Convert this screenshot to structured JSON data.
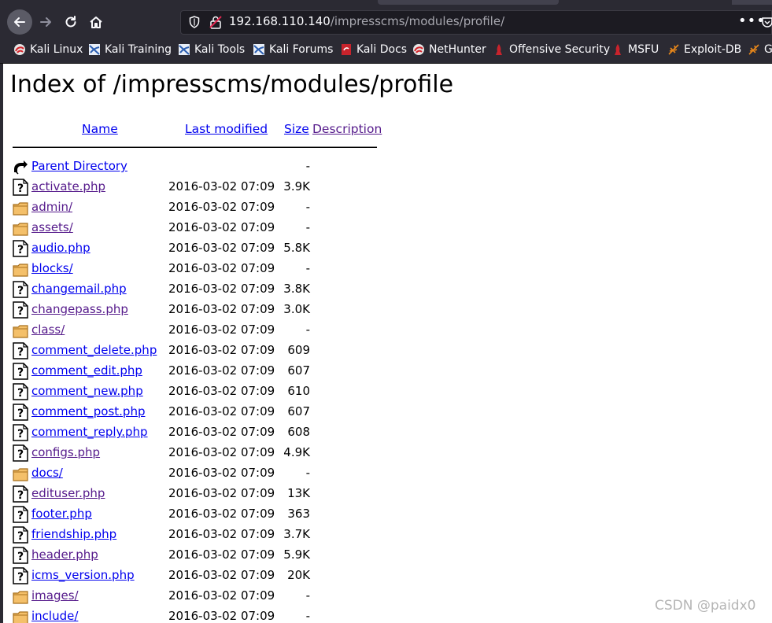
{
  "browser": {
    "url_host": "192.168.110.140",
    "url_path": "/impresscms/modules/profile/",
    "menu_glyph": "•••"
  },
  "bookmarks": [
    {
      "label": "Kali Linux",
      "icon": "kali-red-icon"
    },
    {
      "label": "Kali Training",
      "icon": "kali-blue-icon"
    },
    {
      "label": "Kali Tools",
      "icon": "kali-blue-icon"
    },
    {
      "label": "Kali Forums",
      "icon": "kali-blue-icon"
    },
    {
      "label": "Kali Docs",
      "icon": "kali-docs-icon"
    },
    {
      "label": "NetHunter",
      "icon": "kali-red-icon"
    },
    {
      "label": "Offensive Security",
      "icon": "offsec-icon"
    },
    {
      "label": "MSFU",
      "icon": "offsec-icon"
    },
    {
      "label": "Exploit-DB",
      "icon": "exploitdb-icon"
    },
    {
      "label": "G",
      "icon": "exploitdb-icon"
    }
  ],
  "page": {
    "title": "Index of /impresscms/modules/profile",
    "headers": {
      "name": "Name",
      "modified": "Last modified",
      "size": "Size",
      "description": "Description"
    },
    "entries": [
      {
        "name": "Parent Directory",
        "modified": "",
        "size": "-",
        "type": "parent",
        "visited": false
      },
      {
        "name": "activate.php",
        "modified": "2016-03-02 07:09",
        "size": "3.9K",
        "type": "file",
        "visited": true
      },
      {
        "name": "admin/",
        "modified": "2016-03-02 07:09",
        "size": "-",
        "type": "folder",
        "visited": true
      },
      {
        "name": "assets/",
        "modified": "2016-03-02 07:09",
        "size": "-",
        "type": "folder",
        "visited": true
      },
      {
        "name": "audio.php",
        "modified": "2016-03-02 07:09",
        "size": "5.8K",
        "type": "file",
        "visited": false
      },
      {
        "name": "blocks/",
        "modified": "2016-03-02 07:09",
        "size": "-",
        "type": "folder",
        "visited": false
      },
      {
        "name": "changemail.php",
        "modified": "2016-03-02 07:09",
        "size": "3.8K",
        "type": "file",
        "visited": false
      },
      {
        "name": "changepass.php",
        "modified": "2016-03-02 07:09",
        "size": "3.0K",
        "type": "file",
        "visited": true
      },
      {
        "name": "class/",
        "modified": "2016-03-02 07:09",
        "size": "-",
        "type": "folder",
        "visited": true
      },
      {
        "name": "comment_delete.php",
        "modified": "2016-03-02 07:09",
        "size": "609",
        "type": "file",
        "visited": false
      },
      {
        "name": "comment_edit.php",
        "modified": "2016-03-02 07:09",
        "size": "607",
        "type": "file",
        "visited": false
      },
      {
        "name": "comment_new.php",
        "modified": "2016-03-02 07:09",
        "size": "610",
        "type": "file",
        "visited": false
      },
      {
        "name": "comment_post.php",
        "modified": "2016-03-02 07:09",
        "size": "607",
        "type": "file",
        "visited": false
      },
      {
        "name": "comment_reply.php",
        "modified": "2016-03-02 07:09",
        "size": "608",
        "type": "file",
        "visited": false
      },
      {
        "name": "configs.php",
        "modified": "2016-03-02 07:09",
        "size": "4.9K",
        "type": "file",
        "visited": true
      },
      {
        "name": "docs/",
        "modified": "2016-03-02 07:09",
        "size": "-",
        "type": "folder",
        "visited": false
      },
      {
        "name": "edituser.php",
        "modified": "2016-03-02 07:09",
        "size": "13K",
        "type": "file",
        "visited": true
      },
      {
        "name": "footer.php",
        "modified": "2016-03-02 07:09",
        "size": "363",
        "type": "file",
        "visited": false
      },
      {
        "name": "friendship.php",
        "modified": "2016-03-02 07:09",
        "size": "3.7K",
        "type": "file",
        "visited": false
      },
      {
        "name": "header.php",
        "modified": "2016-03-02 07:09",
        "size": "5.9K",
        "type": "file",
        "visited": true
      },
      {
        "name": "icms_version.php",
        "modified": "2016-03-02 07:09",
        "size": "20K",
        "type": "file",
        "visited": false
      },
      {
        "name": "images/",
        "modified": "2016-03-02 07:09",
        "size": "-",
        "type": "folder",
        "visited": true
      },
      {
        "name": "include/",
        "modified": "2016-03-02 07:09",
        "size": "-",
        "type": "folder",
        "visited": false
      }
    ]
  },
  "watermark": "CSDN @paidx0"
}
